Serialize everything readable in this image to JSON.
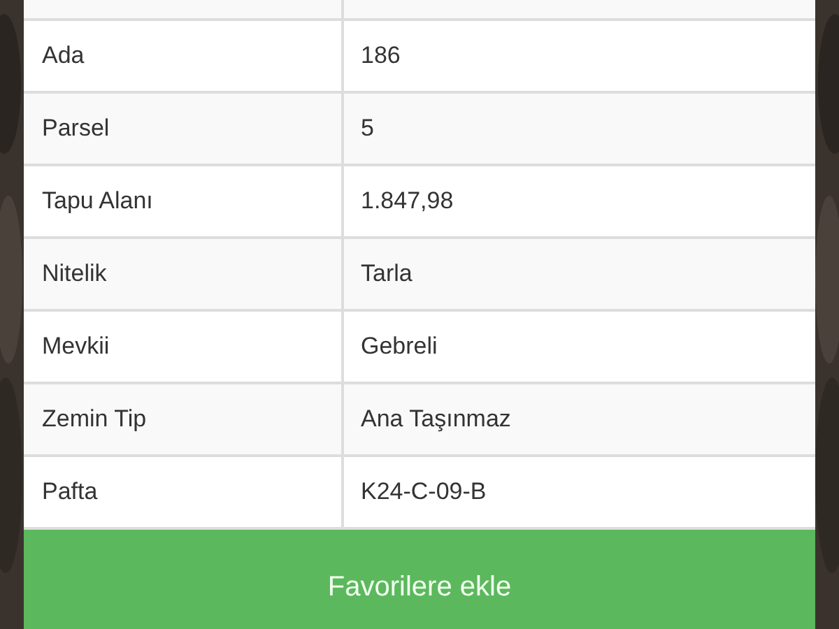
{
  "table": {
    "rows": [
      {
        "label": "Ada",
        "value": "186"
      },
      {
        "label": "Parsel",
        "value": "5"
      },
      {
        "label": "Tapu Alanı",
        "value": "1.847,98"
      },
      {
        "label": "Nitelik",
        "value": "Tarla"
      },
      {
        "label": "Mevkii",
        "value": "Gebreli"
      },
      {
        "label": "Zemin Tip",
        "value": "Ana Taşınmaz"
      },
      {
        "label": "Pafta",
        "value": "K24-C-09-B"
      }
    ]
  },
  "button": {
    "label": "Favorilere ekle"
  }
}
